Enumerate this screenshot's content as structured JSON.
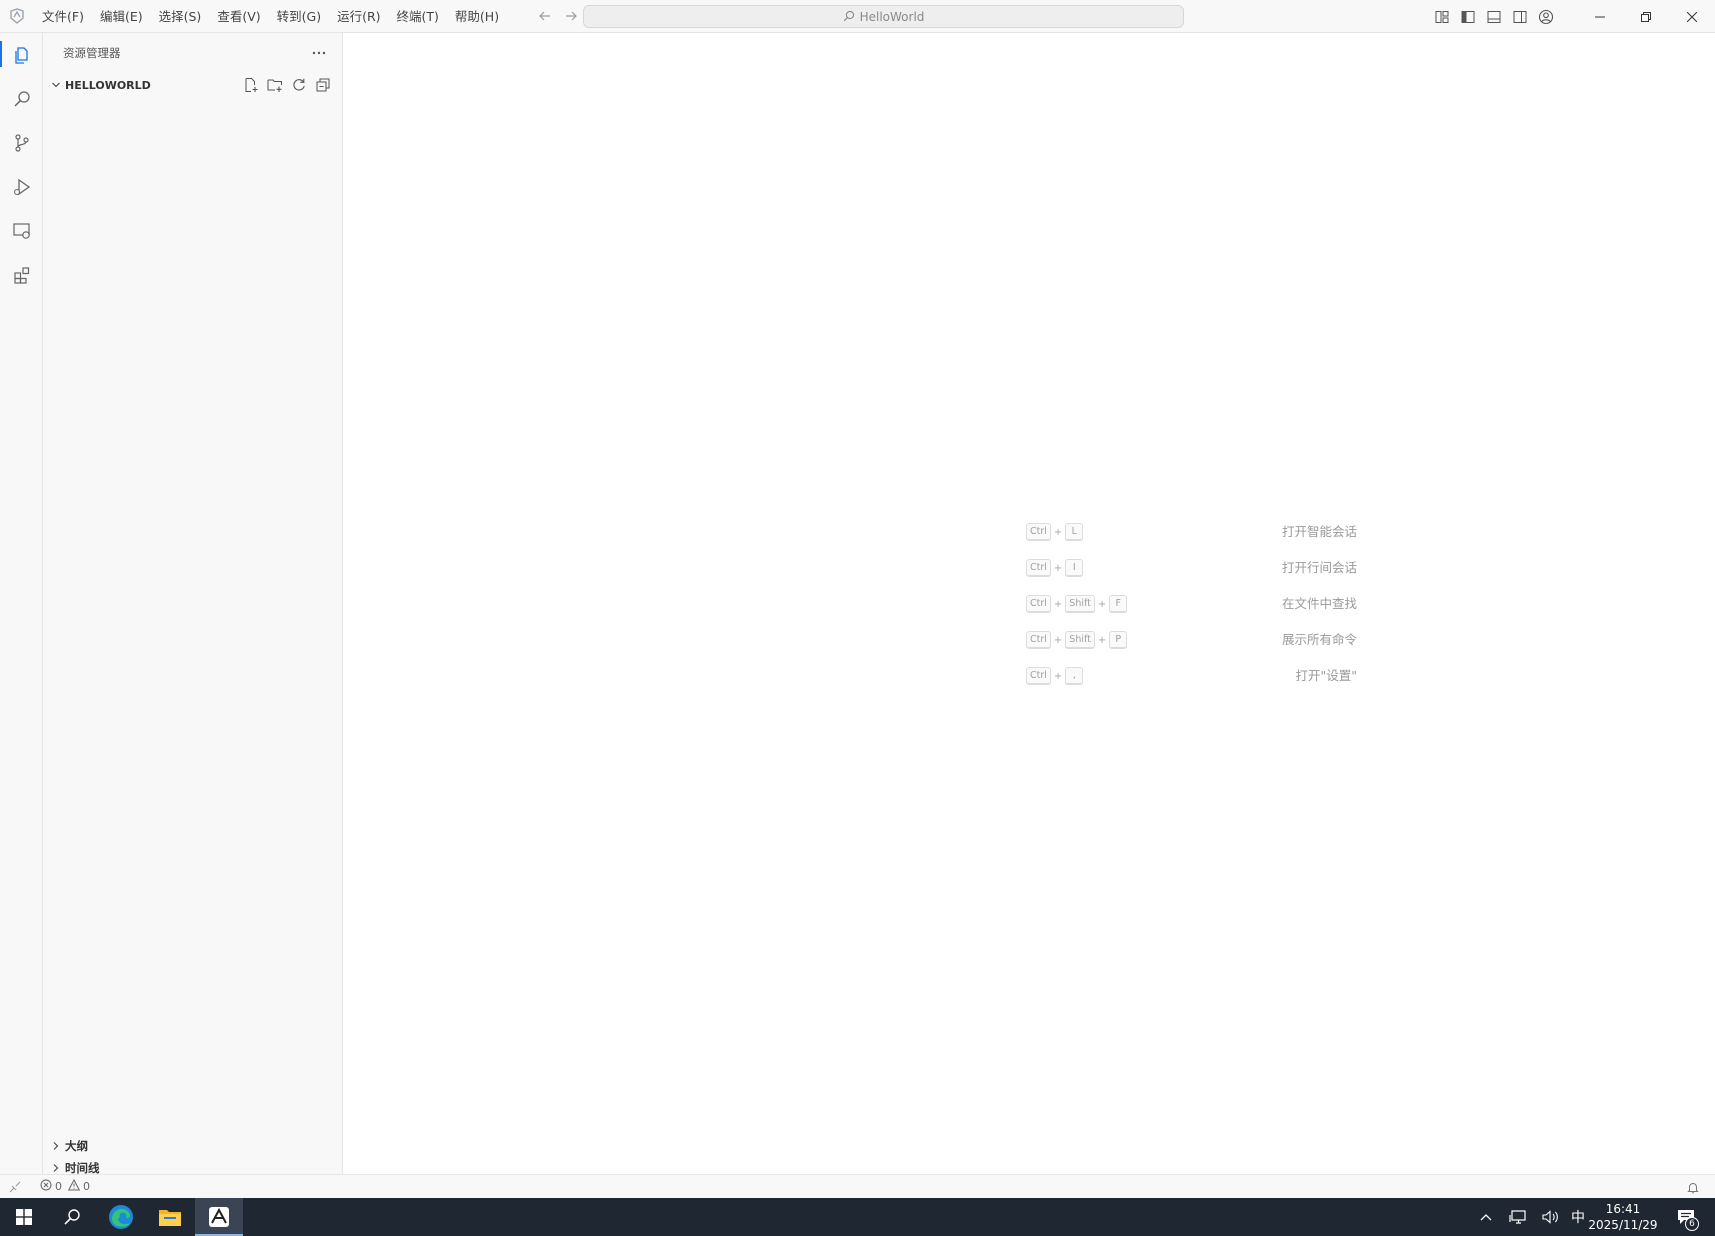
{
  "menu": {
    "items": [
      "文件(F)",
      "编辑(E)",
      "选择(S)",
      "查看(V)",
      "转到(G)",
      "运行(R)",
      "终端(T)",
      "帮助(H)"
    ]
  },
  "command_center": {
    "text": "HelloWorld"
  },
  "sidebar": {
    "title": "资源管理器",
    "folder": "HELLOWORLD",
    "panes": [
      "大纲",
      "时间线"
    ]
  },
  "shortcuts": [
    {
      "label": "打开智能会话",
      "keys": [
        "Ctrl",
        "L"
      ]
    },
    {
      "label": "打开行间会话",
      "keys": [
        "Ctrl",
        "I"
      ]
    },
    {
      "label": "在文件中查找",
      "keys": [
        "Ctrl",
        "Shift",
        "F"
      ]
    },
    {
      "label": "展示所有命令",
      "keys": [
        "Ctrl",
        "Shift",
        "P"
      ]
    },
    {
      "label": "打开\"设置\"",
      "keys": [
        "Ctrl",
        ","
      ]
    }
  ],
  "statusbar": {
    "errors": "0",
    "warnings": "0"
  },
  "taskbar": {
    "ime": "中",
    "time": "16:41",
    "date": "2025/11/29",
    "notification_count": "6"
  },
  "colors": {
    "accent": "#1a73e8",
    "taskbar": "#1f2733",
    "chrome": "#f8f8f8"
  }
}
